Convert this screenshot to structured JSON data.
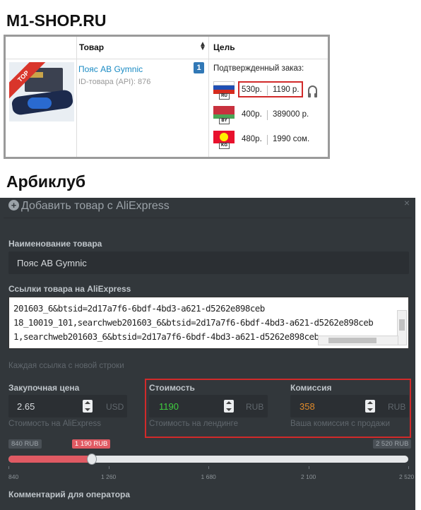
{
  "shop": {
    "title": "M1-SHOP.RU",
    "col_product": "Товар",
    "col_target": "Цель",
    "top_badge": "TOP",
    "product_name": "Пояс AB Gymnic",
    "product_id": "ID-товара (API): 876",
    "count": "1",
    "confirmed_label": "Подтвержденный заказ:",
    "rows": [
      {
        "country": "RU",
        "payout": "530р.",
        "price": "1190 р."
      },
      {
        "country": "BY",
        "payout": "400р.",
        "price": "389000 р."
      },
      {
        "country": "KG",
        "payout": "480р.",
        "price": "1990 сом."
      }
    ],
    "highlight_color": "#d12a2a"
  },
  "club": {
    "title": "Арбиклуб"
  },
  "panel": {
    "title": "Добавить товар с AliExpress",
    "close": "×",
    "name_label": "Наименование товара",
    "name_value": "Пояс AB Gymnic",
    "links_label": "Ссылки товара на AliExpress",
    "links": [
      "201603_6&btsid=2d17a7f6-6bdf-4bd3-a621-d5262e898ceb",
      "18_10019_101,searchweb201603_6&btsid=2d17a7f6-6bdf-4bd3-a621-d5262e898ceb",
      "1,searchweb201603_6&btsid=2d17a7f6-6bdf-4bd3-a621-d5262e898ceb"
    ],
    "links_hint": "Каждая ссылка с новой строки",
    "purchase": {
      "label": "Закупочная цена",
      "value": "2.65",
      "unit": "USD",
      "hint": "Стоимость на AliExpress"
    },
    "cost": {
      "label": "Стоимость",
      "value": "1190",
      "unit": "RUB",
      "hint": "Стоимость на лендинге",
      "color": "#3fcf3f"
    },
    "commission": {
      "label": "Комиссия",
      "value": "358",
      "unit": "RUB",
      "hint": "Ваша комиссия с продажи",
      "color": "#e08a2a"
    },
    "slider": {
      "min_tag": "840 RUB",
      "value_tag": "1 190 RUB",
      "max_tag": "2 520 RUB",
      "min": 840,
      "max": 2520,
      "value": 1190,
      "ticks": [
        "840",
        "1 260",
        "1 680",
        "2 100",
        "2 520"
      ],
      "fill_color": "#e05a63"
    },
    "comment_label": "Комментарий для оператора"
  }
}
